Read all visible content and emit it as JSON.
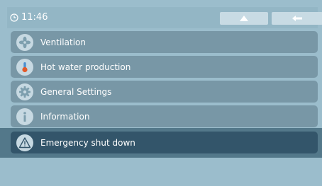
{
  "status_bar": {
    "time": "11:46",
    "icons": {
      "clock": "clock-icon",
      "home": "home-icon",
      "back": "back-arrow-icon"
    }
  },
  "menu": {
    "items": [
      {
        "label": "Ventilation",
        "icon": "fan-icon"
      },
      {
        "label": "Hot water production",
        "icon": "thermometer-icon"
      },
      {
        "label": "General Settings",
        "icon": "gear-icon"
      },
      {
        "label": "Information",
        "icon": "info-icon"
      },
      {
        "label": "Emergency shut down",
        "icon": "warning-icon"
      }
    ]
  },
  "colors": {
    "background": "#9bbdcc",
    "menu_item": "#7897a6",
    "emergency_item": "#33556a",
    "icon_circle": "#c7d9e2"
  }
}
